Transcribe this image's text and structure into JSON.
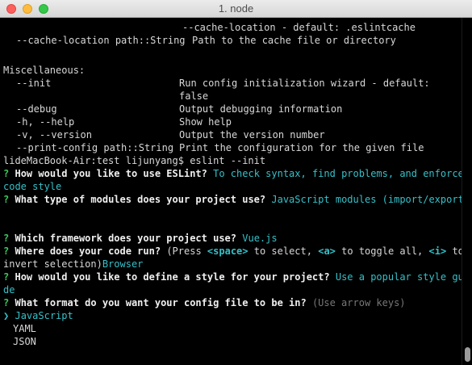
{
  "window": {
    "title": "1. node"
  },
  "colors": {
    "prompt_mark": "#3ec95f",
    "answer": "#35c0c8",
    "hint": "#777777",
    "text": "#d8d8d8"
  },
  "terminal": {
    "help": {
      "l1_default": "--cache-location - default: .eslintcache",
      "l2_opt": "--cache-location path::String",
      "l2_desc": "Path to the cache file or directory",
      "misc_heading": "Miscellaneous:",
      "init_opt": "--init",
      "init_desc": "Run config initialization wizard - default:",
      "init_desc_cont": "false",
      "debug_opt": "--debug",
      "debug_desc": "Output debugging information",
      "help_opt": "-h, --help",
      "help_desc": "Show help",
      "version_opt": "-v, --version",
      "version_desc": "Output the version number",
      "printcfg_opt": "--print-config path::String",
      "printcfg_desc": "Print the configuration for the given file"
    },
    "shell_prompt": "lideMacBook-Air:test lijunyang$ eslint --init",
    "prompt_mark": "?",
    "q1": {
      "question": "How would you like to use ESLint?",
      "answer_part1": "To check syntax, find problems, and enforce",
      "answer_part2": "code style"
    },
    "q2": {
      "question": "What type of modules does your project use?",
      "answer": "JavaScript modules (import/export)"
    },
    "q3": {
      "question": "Which framework does your project use?",
      "answer": "Vue.js"
    },
    "q4": {
      "question": "Where does your code run?",
      "hint_press": "(Press",
      "key_space": "<space>",
      "hint_select": "to select,",
      "key_a": "<a>",
      "hint_toggle": "to toggle all,",
      "key_i": "<i>",
      "hint_to": "to",
      "hint_invert": "invert selection)",
      "answer": "Browser"
    },
    "q5": {
      "question": "How would you like to define a style for your project?",
      "answer": "Use a popular style gui",
      "answer_tail": "de"
    },
    "q6": {
      "question": "What format do you want your config file to be in?",
      "hint": "(Use arrow keys)"
    },
    "options": {
      "pointer": "❯",
      "selected": "JavaScript",
      "items": [
        "YAML",
        "JSON"
      ]
    }
  }
}
